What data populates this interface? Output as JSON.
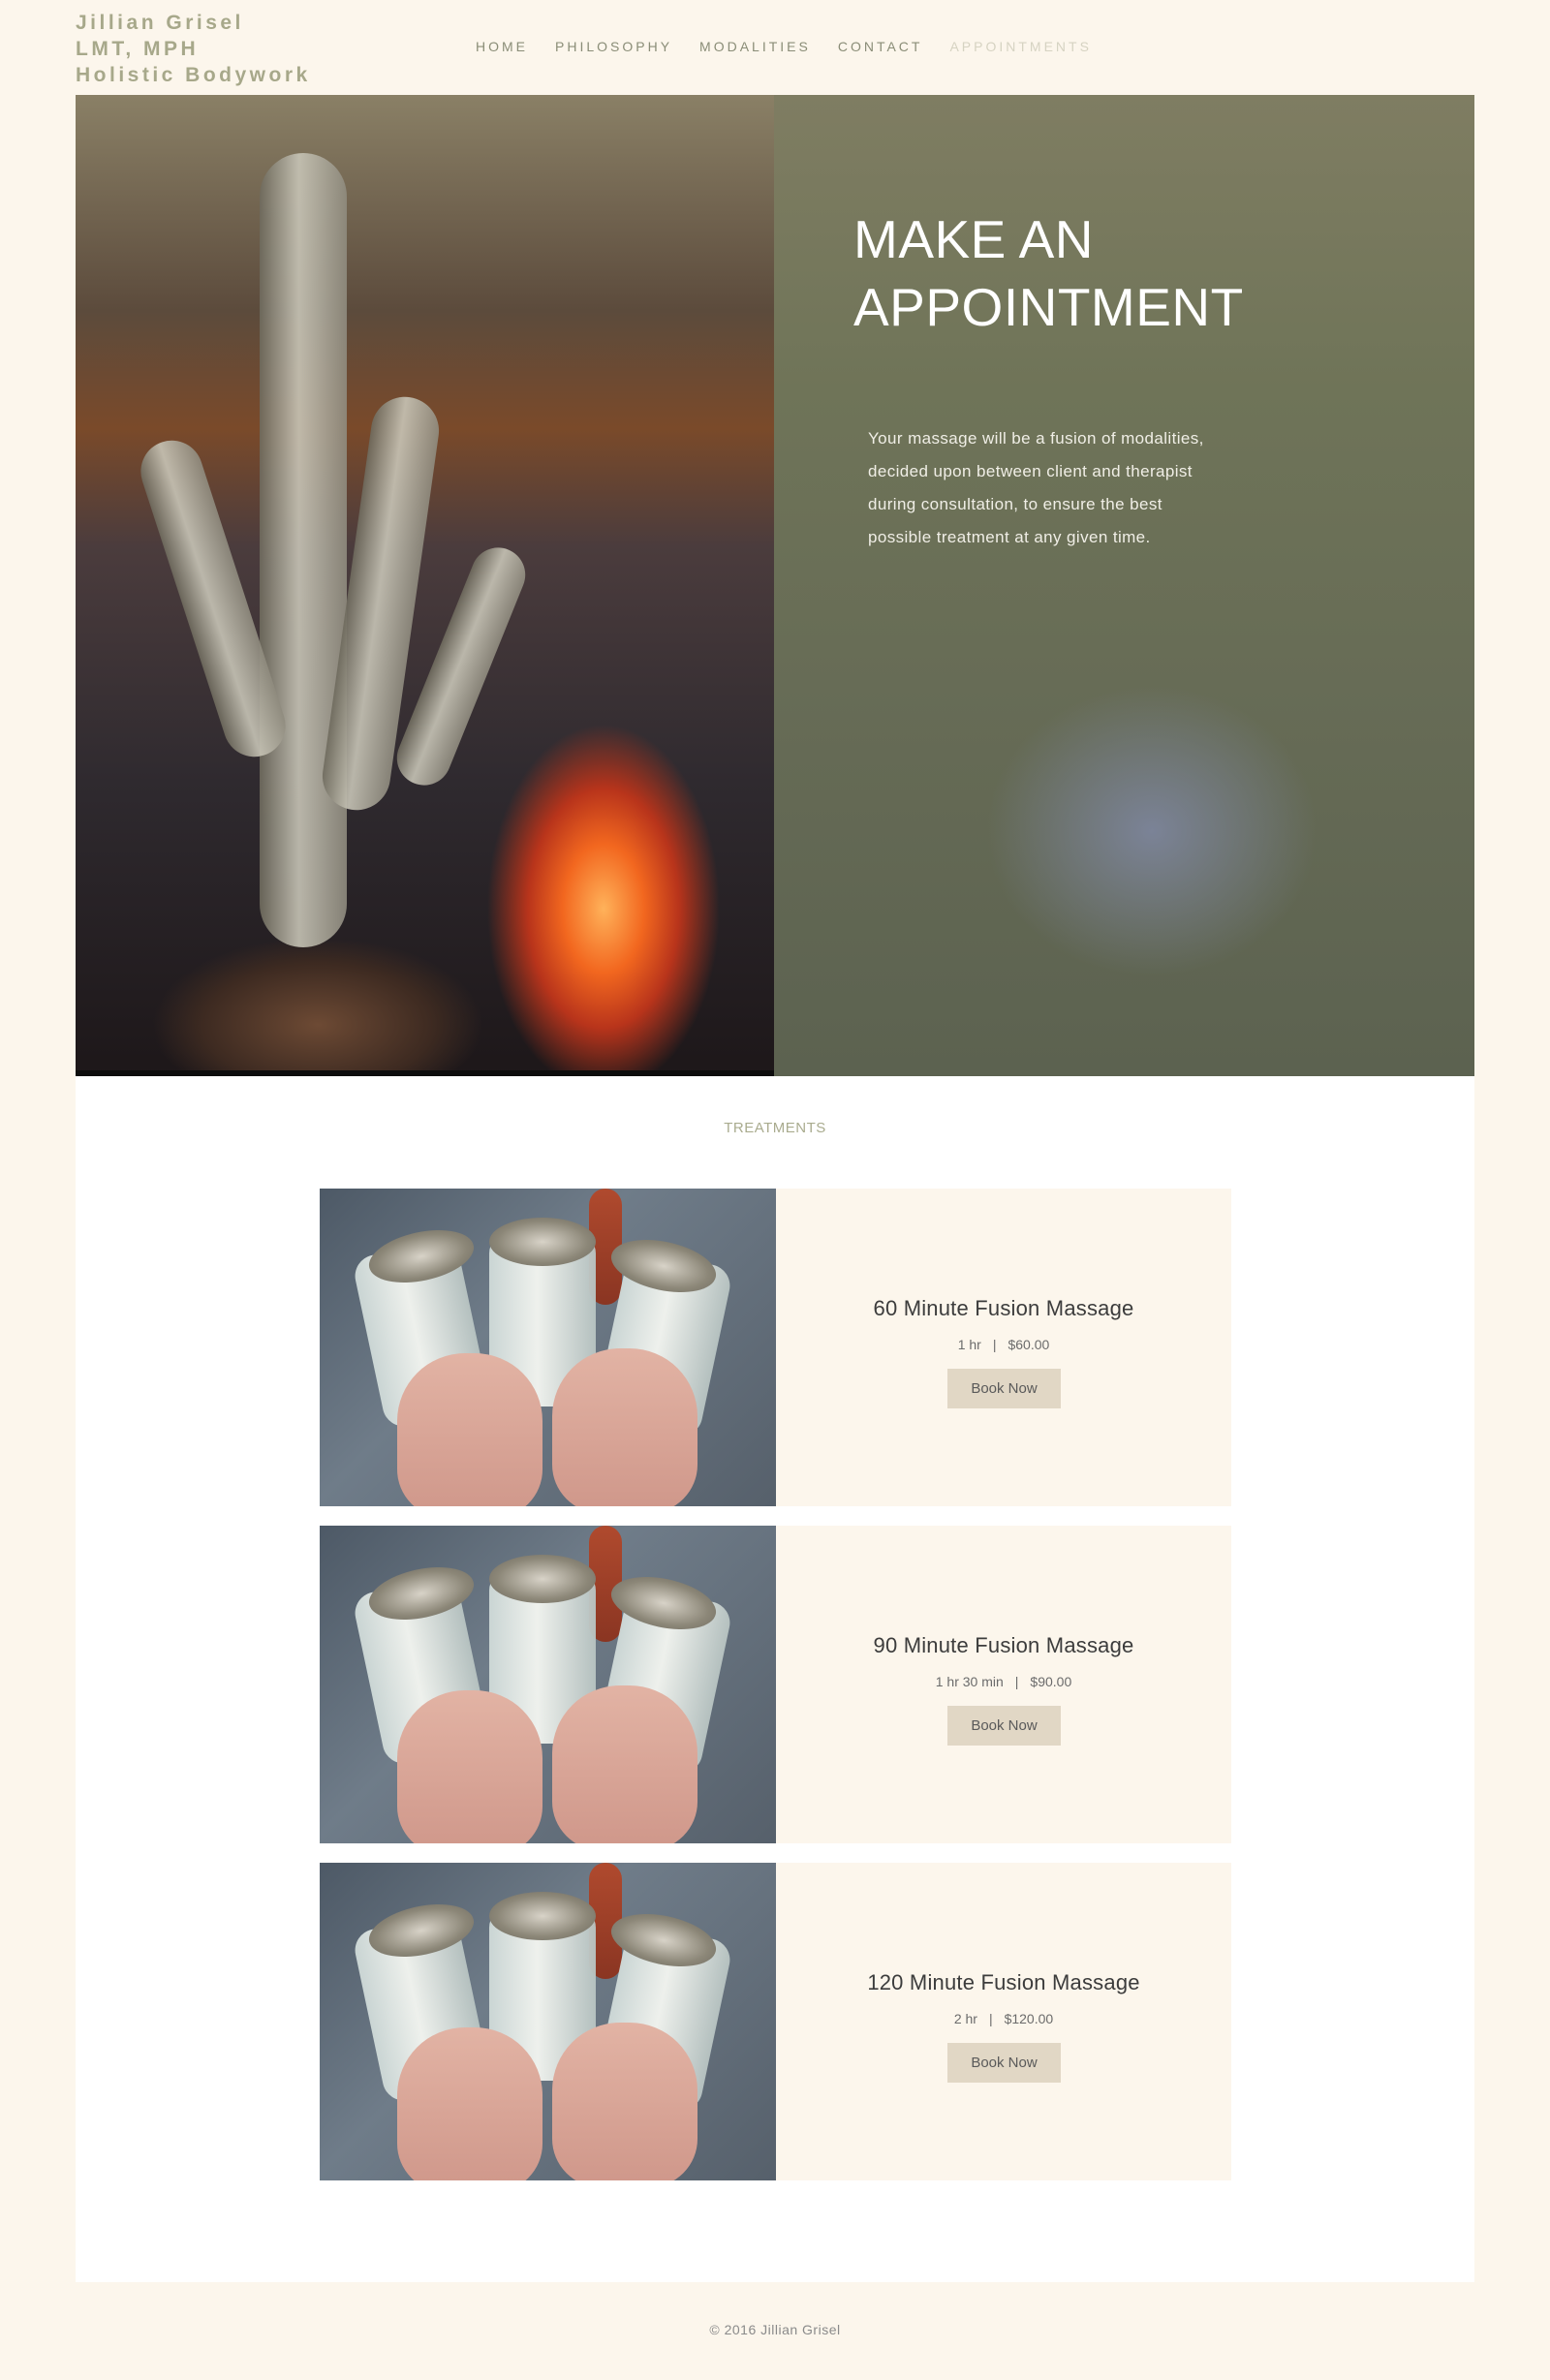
{
  "brand": {
    "line1": "Jillian Grisel",
    "line2": "LMT, MPH",
    "line3": "Holistic Bodywork"
  },
  "nav": {
    "items": [
      "HOME",
      "PHILOSOPHY",
      "MODALITIES",
      "CONTACT",
      "APPOINTMENTS"
    ],
    "active": "APPOINTMENTS"
  },
  "hero": {
    "title_line1": "MAKE AN",
    "title_line2": "APPOINTMENT",
    "text": "Your massage will be a fusion of modalities, decided upon between client and therapist during consultation, to ensure the best possible treatment at any given time."
  },
  "section_title": "TREATMENTS",
  "treatments": [
    {
      "name": "60 Minute Fusion Massage",
      "duration": "1 hr",
      "price": "$60.00",
      "button": "Book Now"
    },
    {
      "name": "90 Minute Fusion Massage",
      "duration": "1 hr 30 min",
      "price": "$90.00",
      "button": "Book Now"
    },
    {
      "name": "120 Minute Fusion Massage",
      "duration": "2 hr",
      "price": "$120.00",
      "button": "Book Now"
    }
  ],
  "meta_separator": "|",
  "footer": "© 2016 Jillian Grisel",
  "colors": {
    "background": "#fcf6ec",
    "brand_text": "#a7a88a",
    "hero_overlay": "#676c56",
    "button": "#e1d7c5"
  }
}
